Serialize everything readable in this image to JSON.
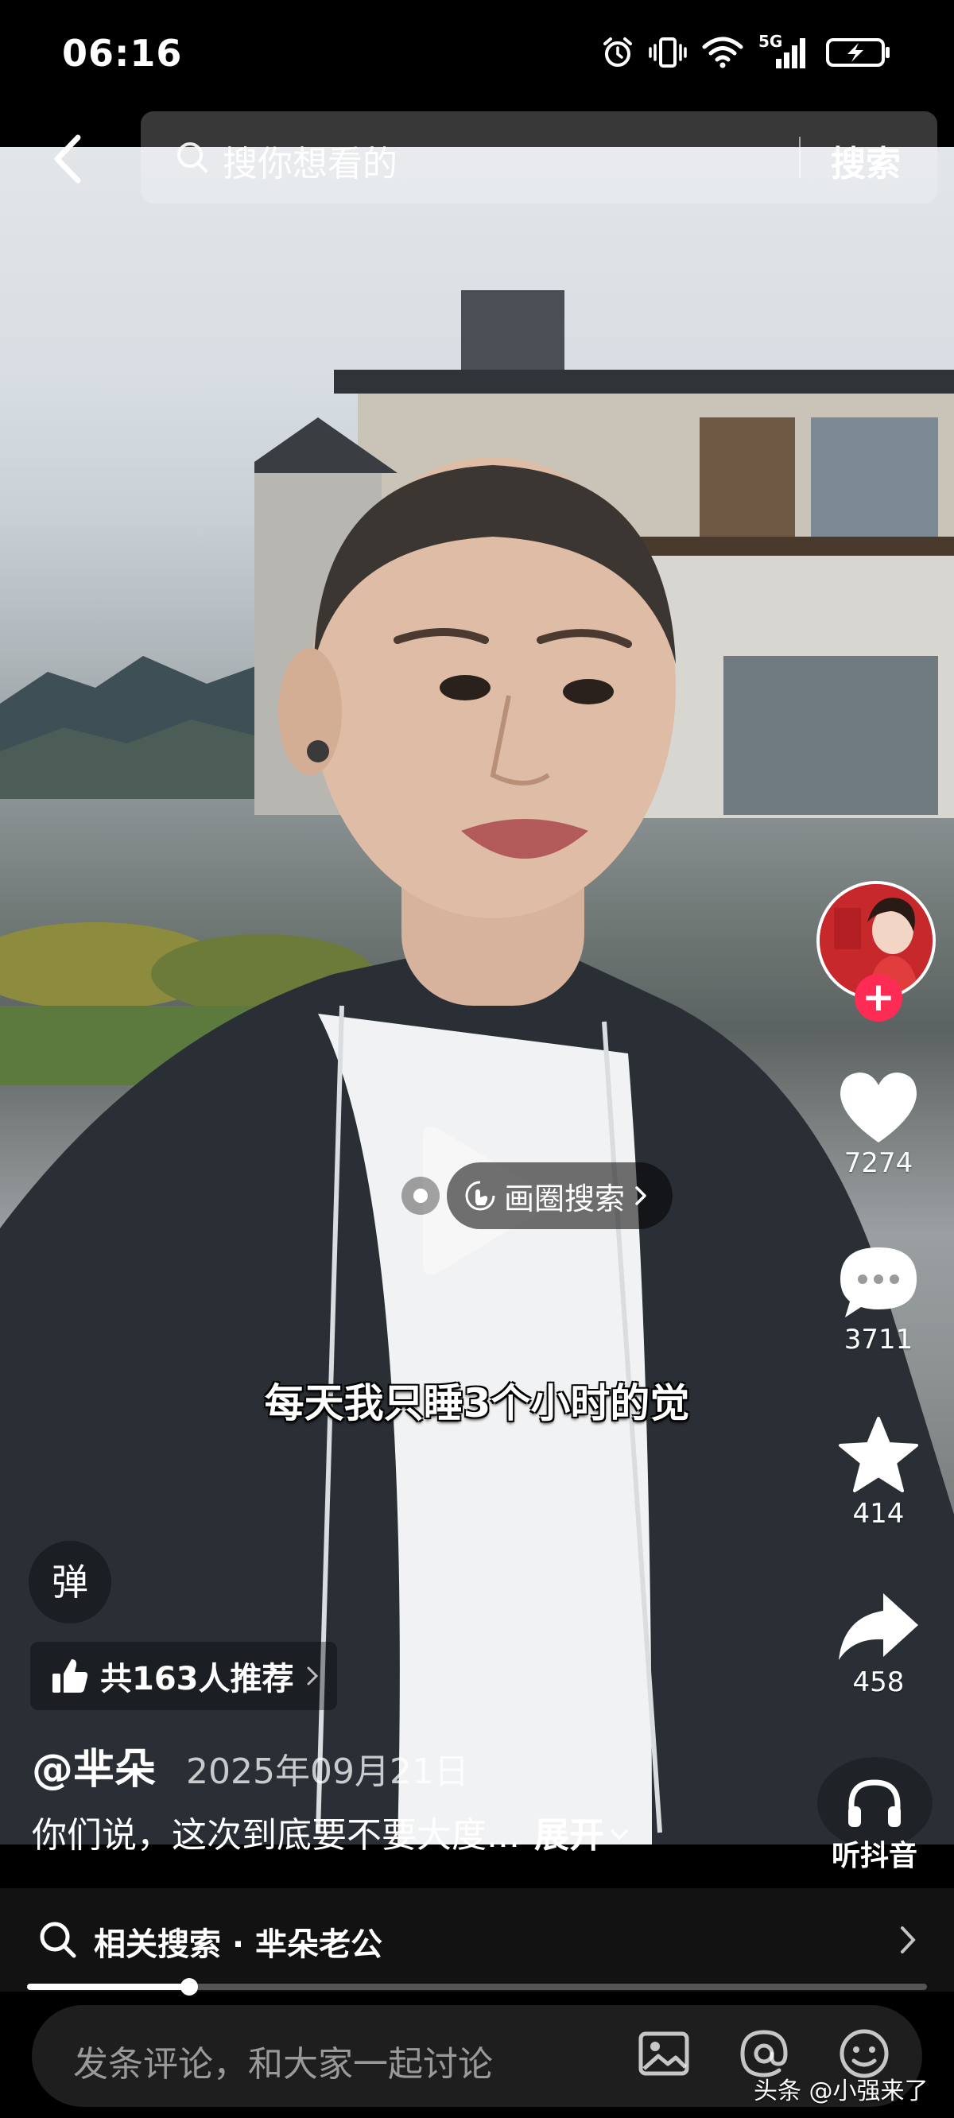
{
  "status_bar": {
    "time": "06:16",
    "network": "5G"
  },
  "top_bar": {
    "search_placeholder": "搜你想看的",
    "search_button": "搜索"
  },
  "video": {
    "subtitle": "每天我只睡3个小时的觉",
    "circle_search_label": "画圈搜索"
  },
  "right_rail": {
    "like_count": "7274",
    "comment_count": "3711",
    "favorite_count": "414",
    "share_count": "458",
    "listen_label": "听抖音"
  },
  "info": {
    "danmu_label": "弹",
    "recommend_label": "共163人推荐",
    "author": "@芈朵",
    "date": "2025年09月21日",
    "description": "你们说，这次到底要不要大度...",
    "expand_label": "展开"
  },
  "related_search": {
    "text": "相关搜索 · 芈朵老公"
  },
  "progress": {
    "fraction": 0.18
  },
  "comment_bar": {
    "placeholder": "发条评论，和大家一起讨论"
  },
  "watermark": "头条 @小强来了",
  "colors": {
    "accent": "#fe2c55",
    "background": "#000000"
  }
}
